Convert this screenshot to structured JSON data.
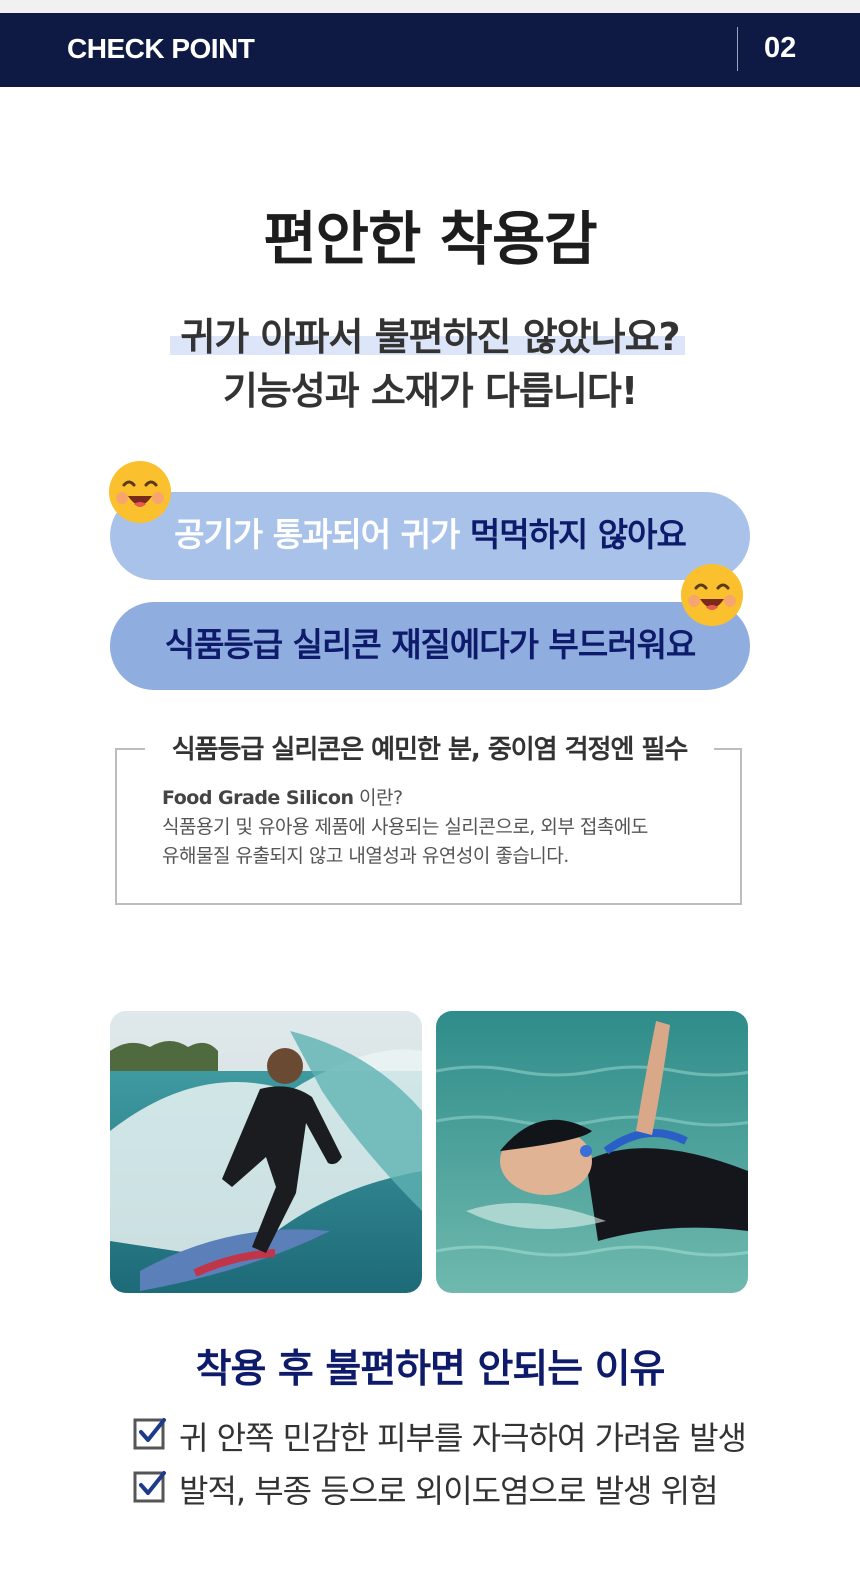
{
  "header": {
    "title": "CHECK POINT",
    "number": "02"
  },
  "main_title": "편안한 착용감",
  "subtitle": {
    "line1": "귀가 아파서 불편하진 않았나요?",
    "line2": "기능성과 소재가 다릅니다!"
  },
  "pills": {
    "first_light": "공기가 통과되어 귀가 ",
    "first_dark": "먹먹하지 않아요",
    "second": "식품등급 실리콘 재질에다가 부드러워요"
  },
  "info_box": {
    "title": "식품등급 실리콘은 예민한 분, 중이염 걱정엔 필수",
    "term": "Food Grade Silicon",
    "question": " 이란?",
    "line2": "식품용기 및 유아용 제품에 사용되는 실리콘으로, 외부 접촉에도",
    "line3": "유해물질 유출되지 않고 내열성과 유연성이 좋습니다."
  },
  "reasons": {
    "title": "착용 후 불편하면 안되는 이유",
    "items": [
      "귀 안쪽 민감한 피부를 자극하여 가려움 발생",
      "발적, 부종 등으로 외이도염으로 발생 위험"
    ]
  },
  "colors": {
    "navy": "#0e1a44",
    "accent_text": "#0e1a6a",
    "pill_light": "#a9c2ea",
    "pill_mid": "#8fadde",
    "highlight": "#dde6f8"
  },
  "icons": [
    "smile-emoji-icon",
    "checkbox-checked-icon"
  ]
}
